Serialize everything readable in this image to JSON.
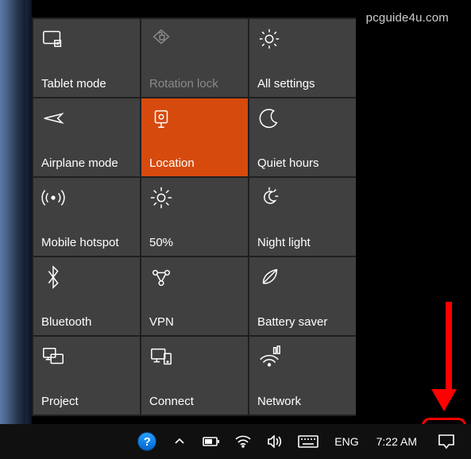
{
  "watermark": "pcguide4u.com",
  "tiles": [
    {
      "id": "tablet-mode",
      "label": "Tablet mode",
      "icon": "tablet-mode-icon",
      "state": "normal"
    },
    {
      "id": "rotation-lock",
      "label": "Rotation lock",
      "icon": "rotation-lock-icon",
      "state": "disabled"
    },
    {
      "id": "all-settings",
      "label": "All settings",
      "icon": "gear-icon",
      "state": "normal"
    },
    {
      "id": "airplane-mode",
      "label": "Airplane mode",
      "icon": "airplane-icon",
      "state": "normal"
    },
    {
      "id": "location",
      "label": "Location",
      "icon": "location-icon",
      "state": "accent"
    },
    {
      "id": "quiet-hours",
      "label": "Quiet hours",
      "icon": "moon-icon",
      "state": "normal"
    },
    {
      "id": "mobile-hotspot",
      "label": "Mobile hotspot",
      "icon": "hotspot-icon",
      "state": "normal"
    },
    {
      "id": "brightness",
      "label": "50%",
      "icon": "sun-icon",
      "state": "normal"
    },
    {
      "id": "night-light",
      "label": "Night light",
      "icon": "night-light-icon",
      "state": "normal"
    },
    {
      "id": "bluetooth",
      "label": "Bluetooth",
      "icon": "bluetooth-icon",
      "state": "normal"
    },
    {
      "id": "vpn",
      "label": "VPN",
      "icon": "vpn-icon",
      "state": "normal"
    },
    {
      "id": "battery-saver",
      "label": "Battery saver",
      "icon": "leaf-icon",
      "state": "normal"
    },
    {
      "id": "project",
      "label": "Project",
      "icon": "project-icon",
      "state": "normal"
    },
    {
      "id": "connect",
      "label": "Connect",
      "icon": "connect-icon",
      "state": "normal"
    },
    {
      "id": "network",
      "label": "Network",
      "icon": "network-icon",
      "state": "normal"
    }
  ],
  "taskbar": {
    "help": "?",
    "language": "ENG",
    "clock": "7:22 AM"
  },
  "colors": {
    "accent": "#d64a0e",
    "tile_bg": "#404040",
    "highlight": "#ff0000"
  }
}
